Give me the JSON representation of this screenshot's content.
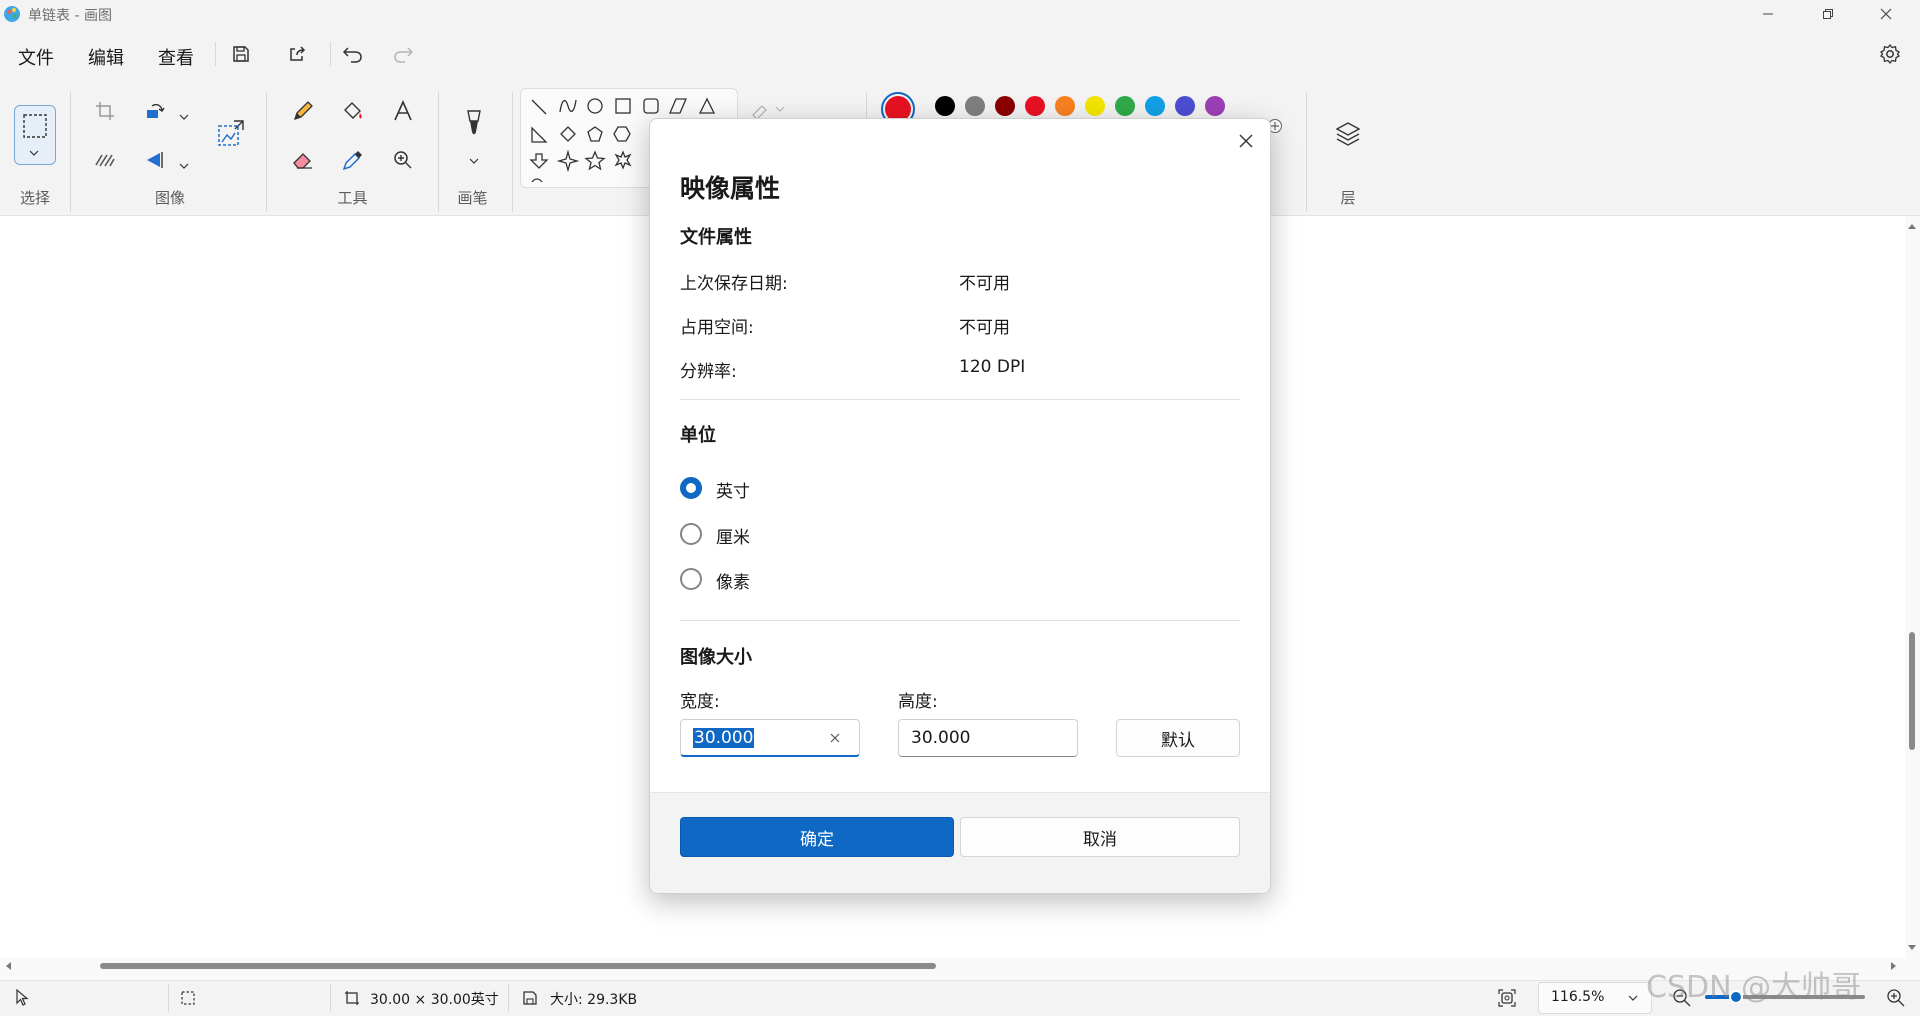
{
  "window": {
    "title": "单链表 - 画图"
  },
  "menu": {
    "file": "文件",
    "edit": "编辑",
    "view": "查看"
  },
  "ribbon": {
    "groups": {
      "select": "选择",
      "image": "图像",
      "tools": "工具",
      "brushes": "画笔",
      "layers": "层"
    },
    "palette": [
      "#000000",
      "#7f7f7f",
      "#8b0000",
      "#e81123",
      "#f7801f",
      "#f3e500",
      "#2faa4a",
      "#12a0e6",
      "#4b4ed1",
      "#9b3fb5"
    ],
    "active_color": "#e81123"
  },
  "dialog": {
    "title": "映像属性",
    "file_props_heading": "文件属性",
    "last_saved_label": "上次保存日期:",
    "last_saved_value": "不可用",
    "size_on_disk_label": "占用空间:",
    "size_on_disk_value": "不可用",
    "resolution_label": "分辨率:",
    "resolution_value": "120 DPI",
    "units_heading": "单位",
    "units": [
      {
        "label": "英寸",
        "selected": true
      },
      {
        "label": "厘米",
        "selected": false
      },
      {
        "label": "像素",
        "selected": false
      }
    ],
    "image_size_heading": "图像大小",
    "width_label": "宽度:",
    "width_value": "30.000",
    "height_label": "高度:",
    "height_value": "30.000",
    "default_button": "默认",
    "ok_button": "确定",
    "cancel_button": "取消"
  },
  "status": {
    "canvas_size": "30.00 × 30.00英寸",
    "file_size": "大小: 29.3KB",
    "zoom": "116.5%"
  },
  "watermark": "CSDN @大帅哥"
}
